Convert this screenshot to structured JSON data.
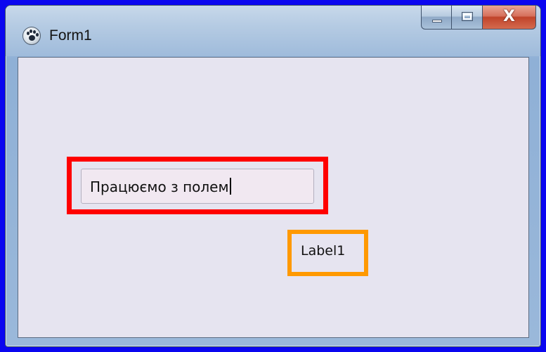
{
  "window": {
    "title": "Form1",
    "icon": "paw-icon",
    "caption_buttons": {
      "minimize": "minimize-icon",
      "maximize": "maximize-icon",
      "close_label": "X"
    }
  },
  "form": {
    "edit": {
      "value": "Працюємо з полем"
    },
    "label": {
      "text": "Label1"
    }
  },
  "colors": {
    "outer_border": "#0a06f0",
    "edit_highlight": "#ff0000",
    "label_highlight": "#ff9900",
    "client_background": "#e6e4f0",
    "close_button": "#c0432a"
  }
}
